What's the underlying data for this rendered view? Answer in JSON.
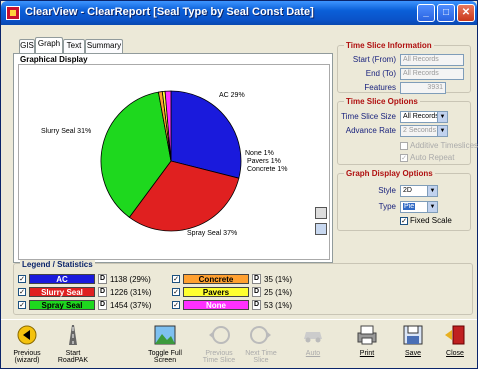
{
  "window": {
    "title": "ClearView - ClearReport [Seal Type by Seal Const Date]"
  },
  "tabs": [
    "GIS",
    "Graph",
    "Text",
    "Summary"
  ],
  "graph": {
    "title": "Graphical Display",
    "labels": {
      "ac": "AC 29%",
      "slurry": "Slurry Seal 31%",
      "spray": "Spray Seal 37%",
      "none": "None 1%",
      "pavers": "Pavers 1%",
      "concrete": "Concrete 1%"
    }
  },
  "chart_data": {
    "type": "pie",
    "labels": [
      "AC",
      "Slurry Seal",
      "Spray Seal",
      "Concrete",
      "Pavers",
      "None"
    ],
    "values": [
      1138,
      1226,
      1454,
      35,
      25,
      53
    ],
    "percent": [
      29,
      31,
      37,
      1,
      1,
      1
    ],
    "colors": [
      "#1a1adc",
      "#e02020",
      "#1ed81e",
      "#ffa030",
      "#ffff30",
      "#ff30ff"
    ]
  },
  "time_slice_info": {
    "title": "Time Slice Information",
    "start_label": "Start (From)",
    "start_value": "All Records",
    "end_label": "End (To)",
    "end_value": "All Records",
    "features_label": "Features",
    "features_value": "3931"
  },
  "time_slice_options": {
    "title": "Time Slice Options",
    "size_label": "Time Slice Size",
    "size_value": "All Records",
    "advance_label": "Advance Rate",
    "advance_value": "2 Seconds",
    "additive_label": "Additive Timeslices",
    "auto_repeat_label": "Auto Repeat"
  },
  "graph_display_options": {
    "title": "Graph Display Options",
    "style_label": "Style",
    "style_value": "2D",
    "type_label": "Type",
    "type_value": "Pie",
    "fixed_scale_label": "Fixed Scale"
  },
  "legend": {
    "title": "Legend / Statistics",
    "d_label": "D",
    "items": [
      {
        "name": "AC",
        "value": "1138 (29%)",
        "bg": "#1a1adc",
        "fg": "#ffffff"
      },
      {
        "name": "Slurry Seal",
        "value": "1226 (31%)",
        "bg": "#e02020",
        "fg": "#ffffff"
      },
      {
        "name": "Spray Seal",
        "value": "1454 (37%)",
        "bg": "#1ed81e",
        "fg": "#000000"
      },
      {
        "name": "Concrete",
        "value": "35 (1%)",
        "bg": "#ffa030",
        "fg": "#000000"
      },
      {
        "name": "Pavers",
        "value": "25 (1%)",
        "bg": "#ffff30",
        "fg": "#000000"
      },
      {
        "name": "None",
        "value": "53 (1%)",
        "bg": "#ff30ff",
        "fg": "#ffffff"
      }
    ]
  },
  "toolbar": {
    "previous": "Previous",
    "previous_sub": "(wizard)",
    "start": "Start",
    "start_sub": "RoadPAK",
    "toggle": "Toggle Full",
    "toggle_sub": "Screen",
    "prev_ts": "Previous",
    "prev_ts_sub": "Time Slice",
    "next_ts": "Next Time",
    "next_ts_sub": "Slice",
    "auto": "Auto",
    "print": "Print",
    "save": "Save",
    "close": "Close"
  }
}
